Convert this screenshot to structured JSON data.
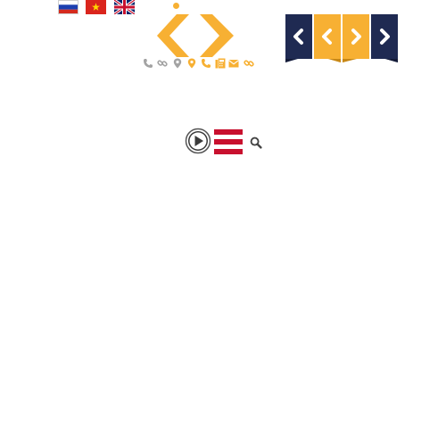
{
  "languages": [
    {
      "name": "flag-russia-icon",
      "code": "ru"
    },
    {
      "name": "flag-vietnam-icon",
      "code": "vi"
    },
    {
      "name": "flag-uk-icon",
      "code": "en"
    }
  ],
  "logo": {
    "icon": "code-brackets-logo",
    "color": "#f7b033"
  },
  "contact_icons": [
    {
      "name": "phone-icon",
      "color": "#a3a3a3"
    },
    {
      "name": "link-icon",
      "color": "#a3a3a3"
    },
    {
      "name": "map-marker-icon",
      "color": "#a3a3a3"
    },
    {
      "name": "map-marker-icon",
      "color": "#f7b033"
    },
    {
      "name": "phone-icon",
      "color": "#f7b033"
    },
    {
      "name": "fax-icon",
      "color": "#f7b033"
    },
    {
      "name": "envelope-icon",
      "color": "#f7b033"
    },
    {
      "name": "link-icon",
      "color": "#f7b033"
    }
  ],
  "nav_ribbons": [
    {
      "name": "prev-navy",
      "icon": "chevron-left-icon",
      "color": "#1f2a52"
    },
    {
      "name": "prev-orange",
      "icon": "chevron-left-icon",
      "color": "#f7b033"
    },
    {
      "name": "next-orange",
      "icon": "chevron-right-icon",
      "color": "#f7b033"
    },
    {
      "name": "next-navy",
      "icon": "chevron-right-icon",
      "color": "#1f2a52"
    }
  ],
  "toolbar": {
    "play_icon": "play-circle-icon",
    "menu_icon": "hamburger-menu-icon",
    "menu_color": "#c8102e",
    "search_icon": "search-icon"
  }
}
